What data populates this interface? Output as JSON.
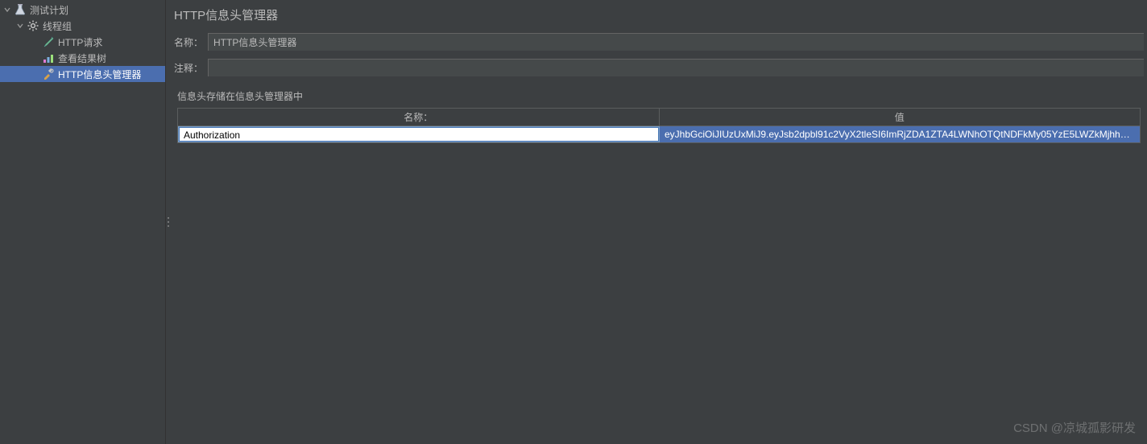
{
  "tree": {
    "root": {
      "label": "测试计划",
      "expanded": true
    },
    "threadGroup": {
      "label": "线程组",
      "expanded": true
    },
    "httpRequest": {
      "label": "HTTP请求"
    },
    "viewResults": {
      "label": "查看结果树"
    },
    "headerManager": {
      "label": "HTTP信息头管理器"
    }
  },
  "panel": {
    "title": "HTTP信息头管理器",
    "nameLabel": "名称：",
    "nameValue": "HTTP信息头管理器",
    "commentLabel": "注释：",
    "commentValue": "",
    "sectionLabel": "信息头存储在信息头管理器中",
    "columns": {
      "name": "名称：",
      "value": "值"
    },
    "rows": [
      {
        "name": "Authorization",
        "value": "eyJhbGciOiJIUzUxMiJ9.eyJsb2dpbl91c2VyX2tleSI6ImRjZDA1ZTA4LWNhOTQtNDFkMy05YzE5LWZkMjhhMmEwMw..."
      }
    ]
  },
  "watermark": "CSDN @凉城孤影研发"
}
